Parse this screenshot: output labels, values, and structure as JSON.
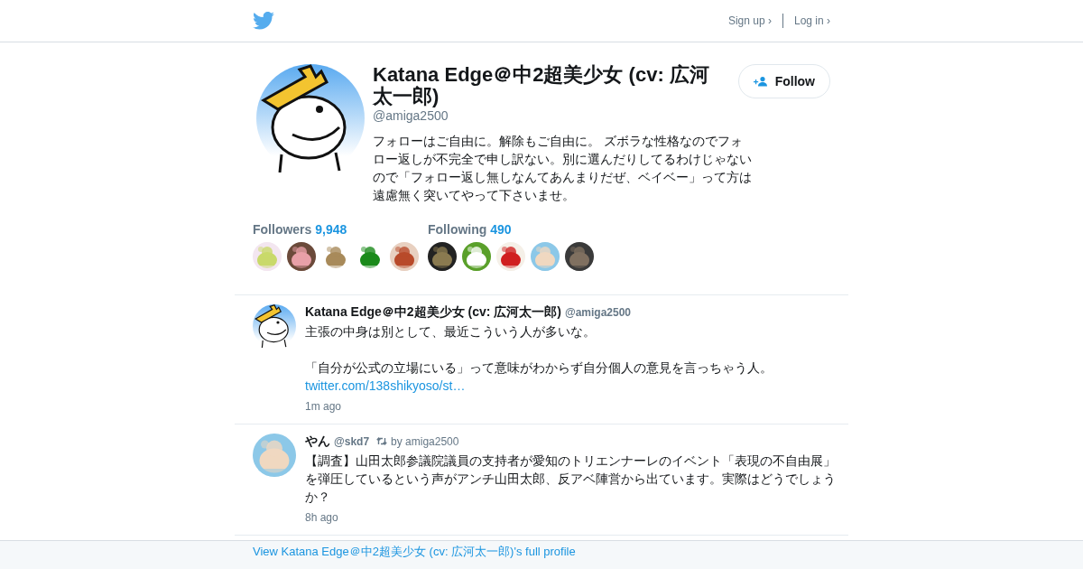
{
  "header": {
    "sign_up": "Sign up ›",
    "log_in": "Log in ›"
  },
  "profile": {
    "name": "Katana Edge＠中2超美少女 (cv: 広河太一郎)",
    "handle": "@amiga2500",
    "bio": "フォローはご自由に。解除もご自由に。 ズボラな性格なのでフォロー返しが不完全で申し訳ない。別に選んだりしてるわけじゃないので「フォロー返し無しなんてあんまりだぜ、ベイベー」って方は遠慮無く突いてやって下さいませ。",
    "follow_button": "Follow"
  },
  "stats": [
    {
      "label": "Followers",
      "count": "9,948"
    },
    {
      "label": "Following",
      "count": "490"
    }
  ],
  "tweets": [
    {
      "name": "Katana Edge＠中2超美少女 (cv: 広河太一郎)",
      "handle": "@amiga2500",
      "paragraphs": [
        "主張の中身は別として、最近こういう人が多いな。",
        "「自分が公式の立場にいる」って意味がわからず自分個人の意見を言っちゃう人。"
      ],
      "link": "twitter.com/138shikyoso/st…",
      "time": "1m ago"
    },
    {
      "name": "やん",
      "handle": "@skd7",
      "retweeted_by": "by amiga2500",
      "paragraphs": [
        "【調査】山田太郎参議院議員の支持者が愛知のトリエンナーレのイベント「表現の不自由展」を弾圧しているという声がアンチ山田太郎、反アベ陣営から出ています。実際はどうでしょうか？"
      ],
      "time": "8h ago"
    }
  ],
  "footer": {
    "link": "View Katana Edge＠中2超美少女 (cv: 広河太一郎)'s full profile"
  }
}
